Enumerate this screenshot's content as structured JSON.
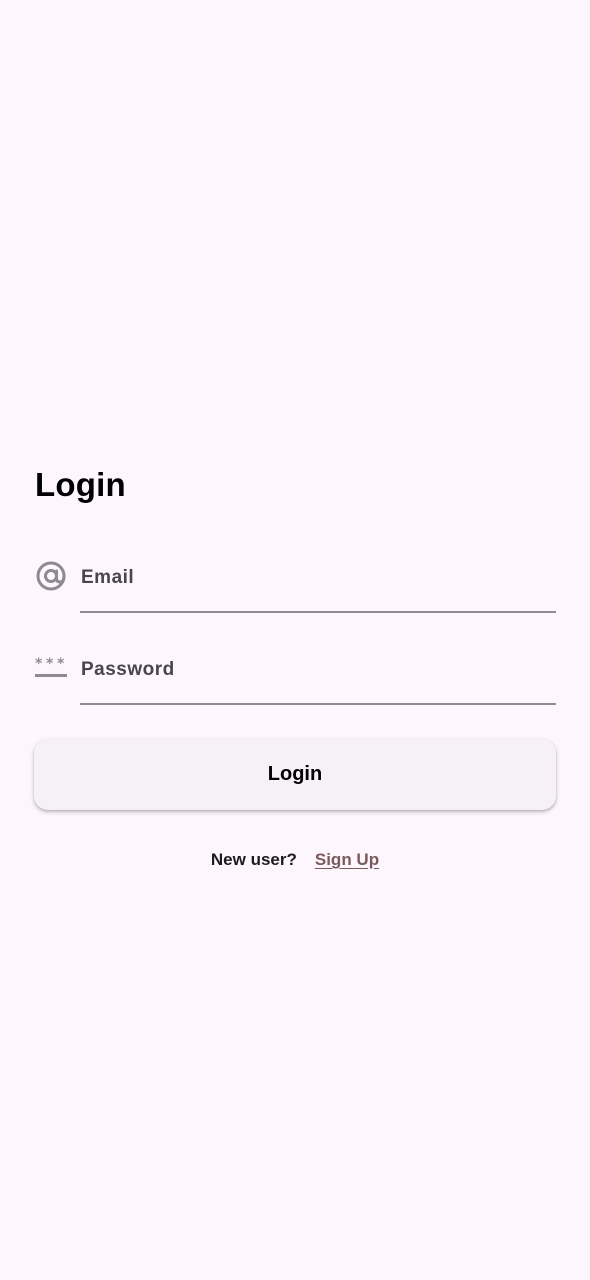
{
  "login": {
    "title": "Login",
    "email": {
      "placeholder": "Email",
      "icon": "at-icon"
    },
    "password": {
      "placeholder": "Password",
      "icon": "password-icon"
    },
    "submit_label": "Login",
    "signup_prompt": "New user?",
    "signup_link": "Sign Up"
  },
  "colors": {
    "background": "#fdf7fd",
    "button_background": "#f6f1f6",
    "field_label": "#49454f",
    "underline": "#8f8a93",
    "link": "#7b5a5a",
    "icon": "#8e8a91"
  }
}
